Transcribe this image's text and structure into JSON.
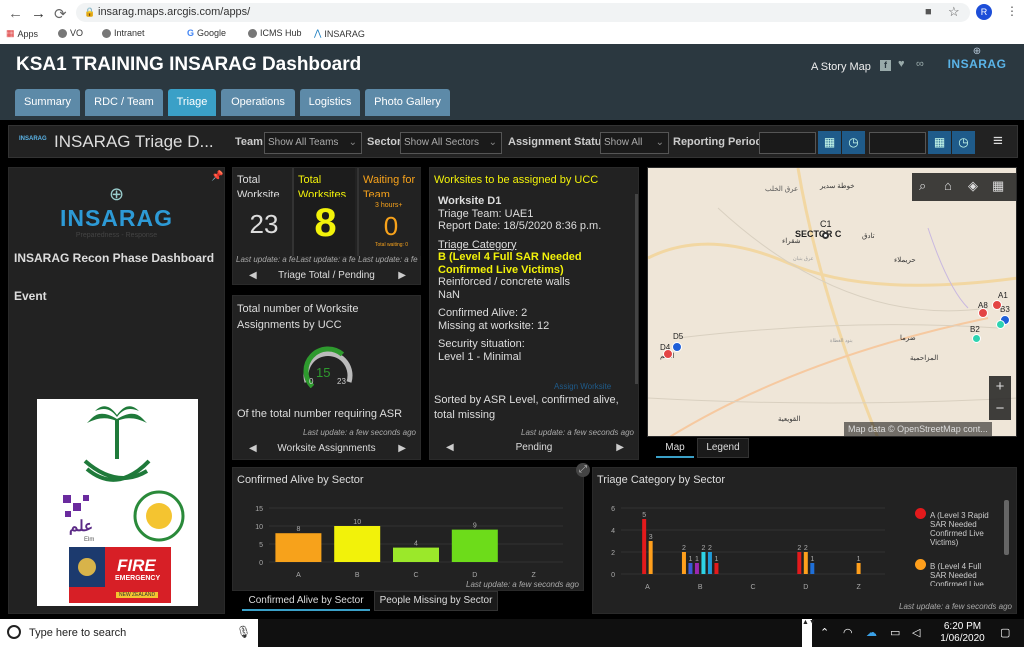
{
  "browser": {
    "url": "insarag.maps.arcgis.com/apps/",
    "bookmarks": [
      "Apps",
      "VO",
      "Intranet",
      "Google",
      "ICMS Hub",
      "INSARAG"
    ],
    "profile_initial": "R"
  },
  "header": {
    "title": "KSA1 TRAINING INSARAG Dashboard",
    "story_map": "A Story Map",
    "logo_text": "INSARAG",
    "tabs": [
      "Summary",
      "RDC / Team",
      "Triage",
      "Operations",
      "Logistics",
      "Photo Gallery"
    ],
    "active_tab": "Triage"
  },
  "dashboard": {
    "logo_text": "INSARAG",
    "title": "INSARAG Triage D...",
    "team_label": "Team",
    "team_value": "Show All Teams",
    "sector_label": "Sector",
    "sector_value": "Show All Sectors",
    "status_label": "Assignment Status",
    "status_value": "Show All",
    "period_label": "Reporting Period"
  },
  "left": {
    "logo_text": "INSARAG",
    "logo_tagline": "Preparedness - Response",
    "recon_title": "INSARAG Recon Phase Dashboard",
    "event": "Event",
    "elm_text": "علم",
    "elm_sub": "Elm",
    "fire_text": "FIRE",
    "fire_sub": "EMERGENCY",
    "fire_foot": "NEW ZEALAND"
  },
  "indicators": {
    "total_worksite": {
      "label": "Total Worksite",
      "value": "23"
    },
    "total_worksites": {
      "label": "Total Worksites",
      "value": "8"
    },
    "waiting": {
      "label": "Waiting for Team",
      "value": "0",
      "top": "3 hours+",
      "bottom": "Total waiting: 0"
    },
    "updates": [
      "Last update: a fe",
      "Last update: a fe",
      "Last update: a fe"
    ],
    "nav_label": "Triage Total / Pending"
  },
  "gauge": {
    "title": "Total number of Worksite Assignments by UCC",
    "value": 15,
    "value_text": "15",
    "min": "0",
    "max": "23",
    "caption": "Of the total number requiring ASR",
    "update": "Last update: a few seconds ago",
    "nav_label": "Worksite Assignments"
  },
  "worksites": {
    "header": "Worksites to be assigned by UCC",
    "name": "Worksite D1",
    "team": "Triage Team:  UAE1",
    "report": "Report Date:  18/5/2020 8:36 p.m.",
    "category_label": "Triage Category",
    "category": "B (Level 4 Full SAR Needed Confirmed Live Victims)",
    "material": "Reinforced / concrete walls",
    "nan": "NaN",
    "alive": "Confirmed Alive:  2",
    "missing": "Missing at worksite:  12",
    "security_label": "Security situation:",
    "security": "Level 1 - Minimal",
    "faded": "Assign Worksite",
    "footer": "Sorted by ASR Level, confirmed alive, total missing",
    "update": "Last update: a few seconds ago",
    "nav_label": "Pending"
  },
  "map": {
    "labels": [
      "خوطة سدير",
      "عرق الخلب",
      "C1",
      "SECTOR C",
      "شقراء",
      "تادق",
      "حريملاء",
      "A8",
      "A1",
      "B3",
      "B2",
      "D5",
      "D4",
      "الدلم",
      "ضرما",
      "المزاحمية",
      "القويعية",
      "عرق بنبان",
      "بنود الغطاة"
    ],
    "attribution": "Map data © OpenStreetMap cont...",
    "zoom_in": "+",
    "zoom_out": "−",
    "tabs": [
      "Map",
      "Legend"
    ],
    "active_tab": "Map"
  },
  "confirmed_chart": {
    "title": "Confirmed Alive by Sector",
    "update": "Last update: a few seconds ago",
    "tabs": [
      "Confirmed Alive by Sector",
      "People Missing by Sector"
    ]
  },
  "triage_chart": {
    "title": "Triage Category by Sector",
    "update": "Last update: a few seconds ago",
    "legend": [
      "A (Level 3 Rapid SAR Needed Confirmed Live Victims)",
      "B (Level 4 Full SAR Needed Confirmed Live Victims)"
    ]
  },
  "chart_data": [
    {
      "type": "bar",
      "title": "Confirmed Alive by Sector",
      "categories": [
        "A",
        "B",
        "C",
        "D",
        "Z"
      ],
      "values": [
        8,
        10,
        4,
        9,
        0
      ],
      "colors": [
        "#f7a21b",
        "#f2f20a",
        "#9be82a",
        "#6ddc1a",
        "#888888"
      ],
      "yticks": [
        "15",
        "10",
        "5",
        "0"
      ],
      "ylim": [
        0,
        15
      ]
    },
    {
      "type": "bar",
      "title": "Triage Category by Sector",
      "categories": [
        "A",
        "B",
        "C",
        "D",
        "Z"
      ],
      "yticks": [
        "6",
        "4",
        "2",
        "0"
      ],
      "ylim": [
        0,
        6
      ],
      "groups": [
        {
          "category": "A",
          "bars": [
            {
              "value": 5,
              "color": "#e31a1c"
            },
            {
              "value": 3,
              "color": "#ff9f1c"
            }
          ]
        },
        {
          "category": "B",
          "bars": [
            {
              "value": 2,
              "color": "#ff9f1c"
            },
            {
              "value": 1,
              "color": "#3a5bd9"
            },
            {
              "value": 1,
              "color": "#9b27b0"
            },
            {
              "value": 2,
              "color": "#2ed3e6"
            },
            {
              "value": 2,
              "color": "#1f9bd8"
            },
            {
              "value": 1,
              "color": "#e31a1c"
            }
          ]
        },
        {
          "category": "C",
          "bars": []
        },
        {
          "category": "D",
          "bars": [
            {
              "value": 2,
              "color": "#e31a1c"
            },
            {
              "value": 2,
              "color": "#ff9f1c"
            },
            {
              "value": 1,
              "color": "#1f6fd8"
            }
          ]
        },
        {
          "category": "Z",
          "bars": [
            {
              "value": 1,
              "color": "#ff9f1c"
            }
          ]
        }
      ]
    }
  ],
  "taskbar": {
    "search": "Type here to search",
    "time": "6:20 PM",
    "date": "1/06/2020"
  },
  "colors": {
    "accent": "#3aa0c7",
    "tab": "#5d8aa8",
    "header": "#2b3840",
    "yellow": "#f2f20a",
    "orange": "#f7a21b"
  }
}
